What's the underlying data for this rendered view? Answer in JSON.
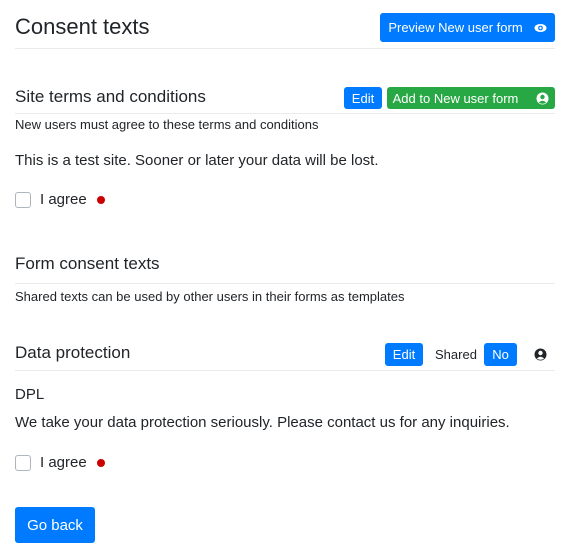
{
  "page": {
    "title": "Consent texts",
    "preview_button": {
      "label": "Preview New user form",
      "icon": "eye-icon"
    }
  },
  "site_terms": {
    "heading": "Site terms and conditions",
    "edit_label": "Edit",
    "add_button": {
      "label": "Add to New user form",
      "icon": "user-circle-icon"
    },
    "description": "New users must agree to these terms and conditions",
    "body": "This is a test site. Sooner or later your data will be lost.",
    "agree_label": "I agree",
    "agree_checked": false,
    "required": true
  },
  "form_consent": {
    "heading": "Form consent texts",
    "description": "Shared texts can be used by other users in their forms as templates"
  },
  "data_protection": {
    "heading": "Data protection",
    "edit_label": "Edit",
    "shared_label": "Shared",
    "shared_value": "No",
    "owner_icon": "user-circle-icon",
    "short_name": "DPL",
    "body": "We take your data protection seriously. Please contact us for any inquiries.",
    "agree_label": "I agree",
    "agree_checked": false,
    "required": true
  },
  "footer": {
    "go_back_label": "Go back"
  },
  "colors": {
    "primary": "#007bff",
    "success": "#28a745",
    "required_dot": "#cc0000"
  }
}
